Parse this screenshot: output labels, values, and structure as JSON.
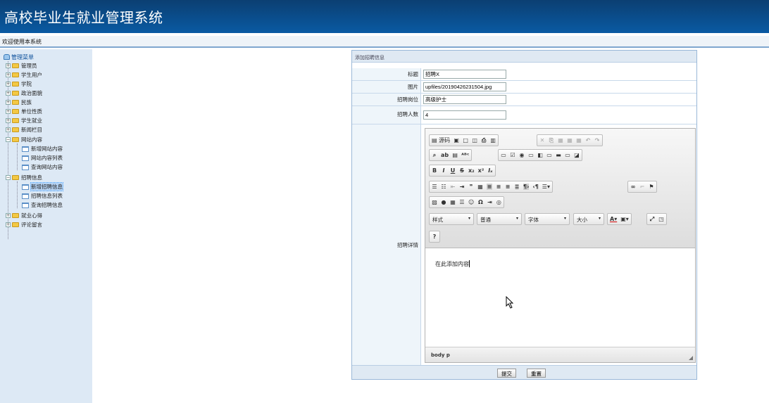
{
  "header": {
    "title": "高校毕业生就业管理系统"
  },
  "welcome": "欢迎使用本系统",
  "sidebar": {
    "root": "管理菜单",
    "items": [
      {
        "label": "管理员"
      },
      {
        "label": "学生用户"
      },
      {
        "label": "学院"
      },
      {
        "label": "政治面貌"
      },
      {
        "label": "民族"
      },
      {
        "label": "单位性质"
      },
      {
        "label": "学生就业"
      },
      {
        "label": "新闻栏目"
      },
      {
        "label": "网站内容",
        "children": [
          "新增网站内容",
          "网站内容列表",
          "查询网站内容"
        ]
      },
      {
        "label": "招聘信息",
        "children": [
          "新增招聘信息",
          "招聘信息列表",
          "查询招聘信息"
        ]
      },
      {
        "label": "就业心得"
      },
      {
        "label": "评论留言"
      }
    ],
    "selected": "新增招聘信息"
  },
  "form": {
    "heading": "添加招聘信息",
    "fields": [
      {
        "label": "标题",
        "value": "招聘X"
      },
      {
        "label": "图片",
        "value": "upfiles/20190426231504.jpg"
      },
      {
        "label": "招聘岗位",
        "value": "高级护士"
      },
      {
        "label": "招聘人数",
        "value": "4"
      }
    ],
    "detail_label": "招聘详情",
    "editor": {
      "source_label": "源码",
      "style_combo": "样式",
      "format_combo": "普通",
      "font_combo": "字体",
      "size_combo": "大小",
      "help": "?",
      "content": "在此添加内容",
      "path": "body  p"
    },
    "submit_label": "提交",
    "reset_label": "重置"
  }
}
